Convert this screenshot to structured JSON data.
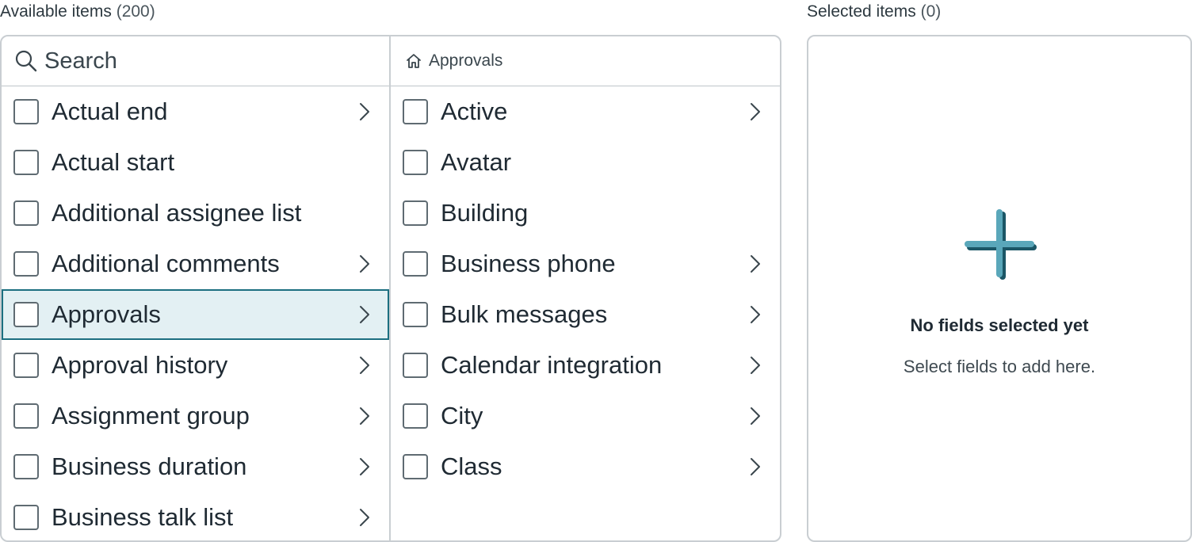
{
  "available": {
    "label": "Available items",
    "count": "(200)",
    "search_placeholder": "Search",
    "breadcrumb": "Approvals",
    "left_items": [
      {
        "label": "Actual end",
        "has_children": true,
        "selected": false
      },
      {
        "label": "Actual start",
        "has_children": false,
        "selected": false
      },
      {
        "label": "Additional assignee list",
        "has_children": false,
        "selected": false
      },
      {
        "label": "Additional comments",
        "has_children": true,
        "selected": false
      },
      {
        "label": "Approvals",
        "has_children": true,
        "selected": true
      },
      {
        "label": "Approval history",
        "has_children": true,
        "selected": false
      },
      {
        "label": "Assignment group",
        "has_children": true,
        "selected": false
      },
      {
        "label": "Business duration",
        "has_children": true,
        "selected": false
      },
      {
        "label": "Business talk list",
        "has_children": true,
        "selected": false
      }
    ],
    "right_items": [
      {
        "label": "Active",
        "has_children": true
      },
      {
        "label": "Avatar",
        "has_children": false
      },
      {
        "label": "Building",
        "has_children": false
      },
      {
        "label": "Business phone",
        "has_children": true
      },
      {
        "label": "Bulk messages",
        "has_children": true
      },
      {
        "label": "Calendar integration",
        "has_children": true
      },
      {
        "label": "City",
        "has_children": true
      },
      {
        "label": "Class",
        "has_children": true
      }
    ]
  },
  "selected": {
    "label": "Selected items",
    "count": "(0)",
    "empty_title": "No fields selected yet",
    "empty_subtitle": "Select fields to add here."
  },
  "colors": {
    "selection_bg": "#e3f0f3",
    "selection_border": "#1c6f80",
    "plus_light": "#5aa7ba",
    "plus_dark": "#1b5666"
  }
}
